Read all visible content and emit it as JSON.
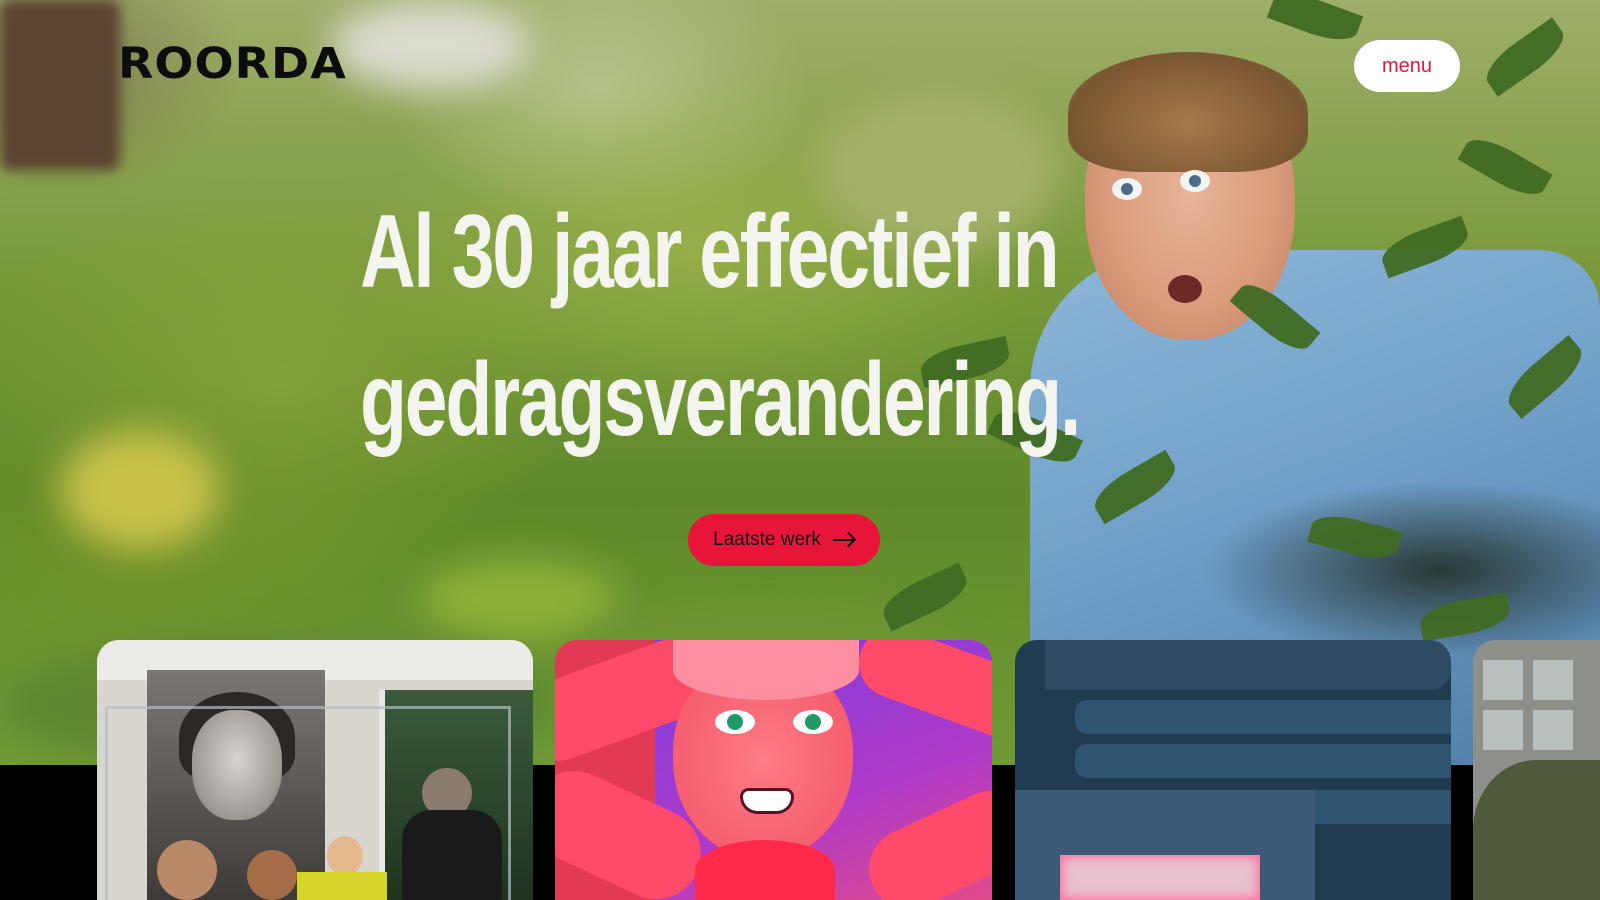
{
  "header": {
    "logo": "ROORDA",
    "menu_label": "menu"
  },
  "hero": {
    "headline_line1": "Al 30 jaar effectief in",
    "headline_line2": "gedragsverandering.",
    "cta_label": "Laatste werk",
    "cta_icon": "arrow-right-icon"
  },
  "colors": {
    "accent": "#e8153a",
    "headline": "#f5f5f0",
    "logo": "#0c0c0c"
  },
  "cards": [
    {
      "name": "project-card-1"
    },
    {
      "name": "project-card-2"
    },
    {
      "name": "project-card-3"
    },
    {
      "name": "project-card-4"
    }
  ]
}
